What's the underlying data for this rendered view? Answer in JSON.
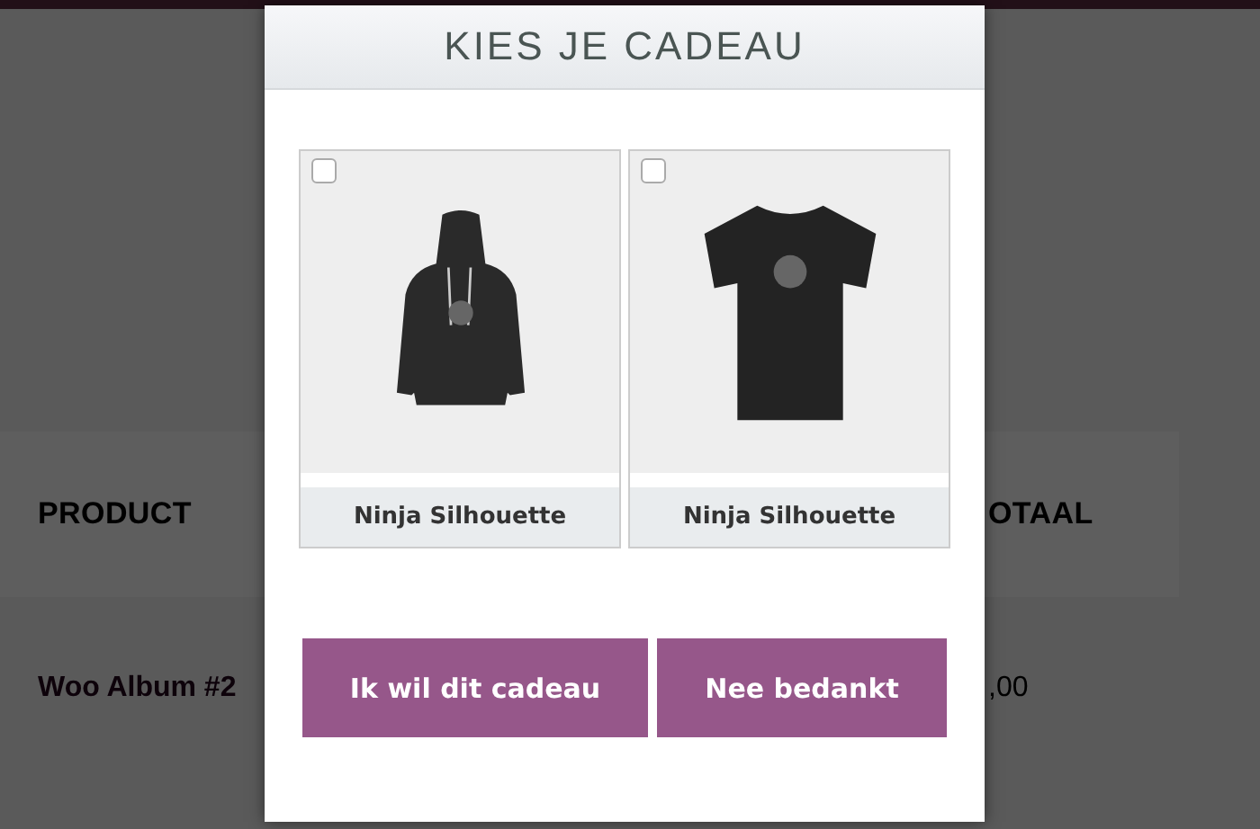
{
  "background": {
    "columns": [
      "PRODUCT",
      "OTAAL"
    ],
    "rows": [
      {
        "product": "Woo Album #2",
        "total": ",00"
      }
    ]
  },
  "modal": {
    "title": "KIES JE CADEAU",
    "gifts": [
      {
        "name": "Ninja Silhouette",
        "kind": "hoodie",
        "checked": false
      },
      {
        "name": "Ninja Silhouette",
        "kind": "tshirt",
        "checked": false
      }
    ],
    "buttons": [
      "Ik wil dit cadeau",
      "Nee bedankt"
    ]
  }
}
